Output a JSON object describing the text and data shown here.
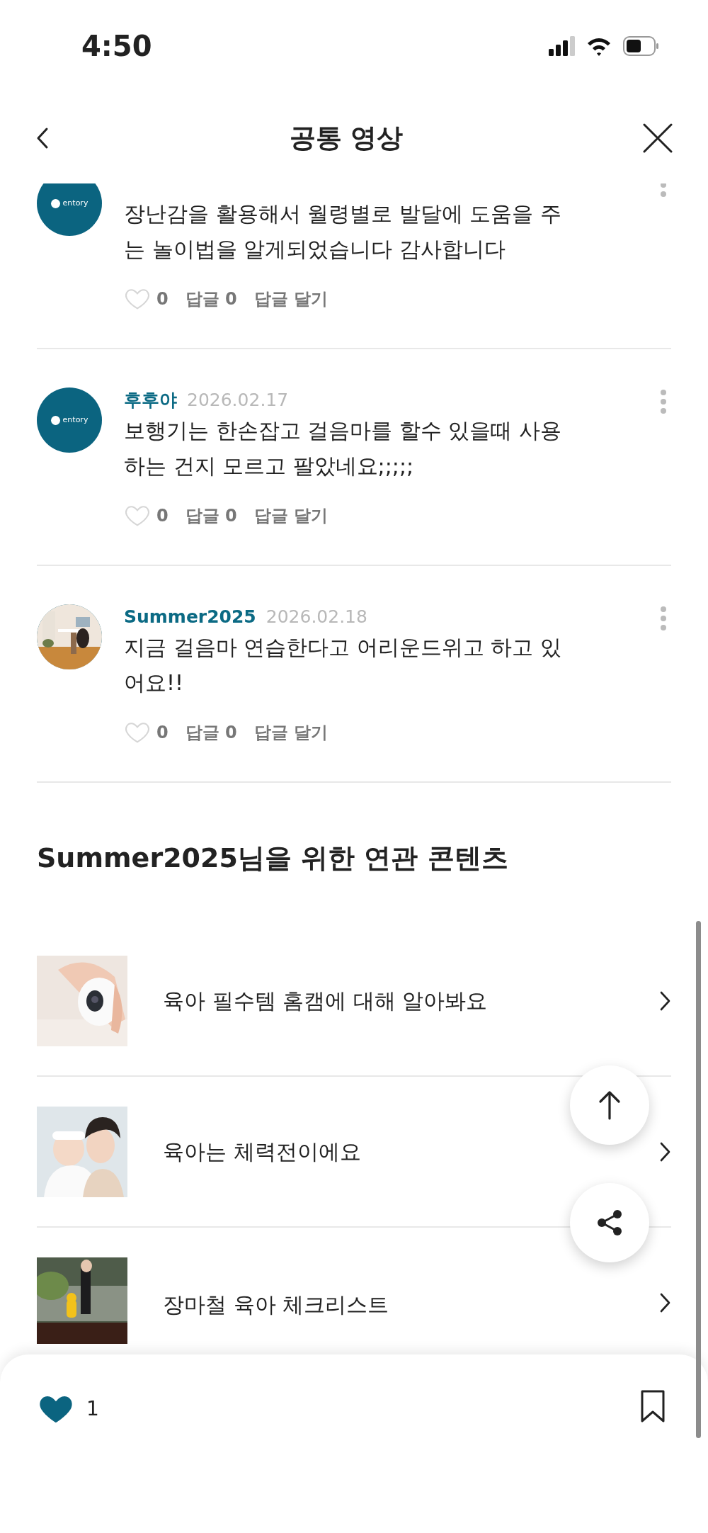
{
  "status_bar": {
    "time": "4:50"
  },
  "header": {
    "title": "공통 영상"
  },
  "comments": [
    {
      "avatar": {
        "kind": "logo",
        "text": "entory"
      },
      "body": "장난감을 활용해서 월령별로 발달에 도움을 주는 놀이법을 알게되었습니다 감사합니다",
      "liked": false,
      "likes": "0",
      "replies": "답글 0",
      "reply_action": "답글 달기"
    },
    {
      "avatar": {
        "kind": "logo",
        "text": "entory"
      },
      "author": "후후야",
      "date": "2026.02.17",
      "body": "보행기는 한손잡고 걸음마를 할수 있을때 사용하는 건지 모르고 팔았네요;;;;;",
      "liked": false,
      "likes": "0",
      "replies": "답글 0",
      "reply_action": "답글 달기"
    },
    {
      "author": "Summer2025",
      "date": "2026.02.18",
      "body": " 지금 걸음마 연습한다고 어리운드위고 하고 있어요!!",
      "liked": false,
      "likes": "0",
      "replies": "답글 0",
      "reply_action": "답글 달기"
    }
  ],
  "related": {
    "title": "Summer2025님을 위한 연관 콘텐츠",
    "items": [
      {
        "title": "육아 필수템 홈캠에 대해 알아봐요"
      },
      {
        "title": "육아는 체력전이에요"
      },
      {
        "title": "장마철 육아 체크리스트"
      }
    ]
  },
  "bottom_bar": {
    "liked": true,
    "likes": "1",
    "saved": false
  }
}
